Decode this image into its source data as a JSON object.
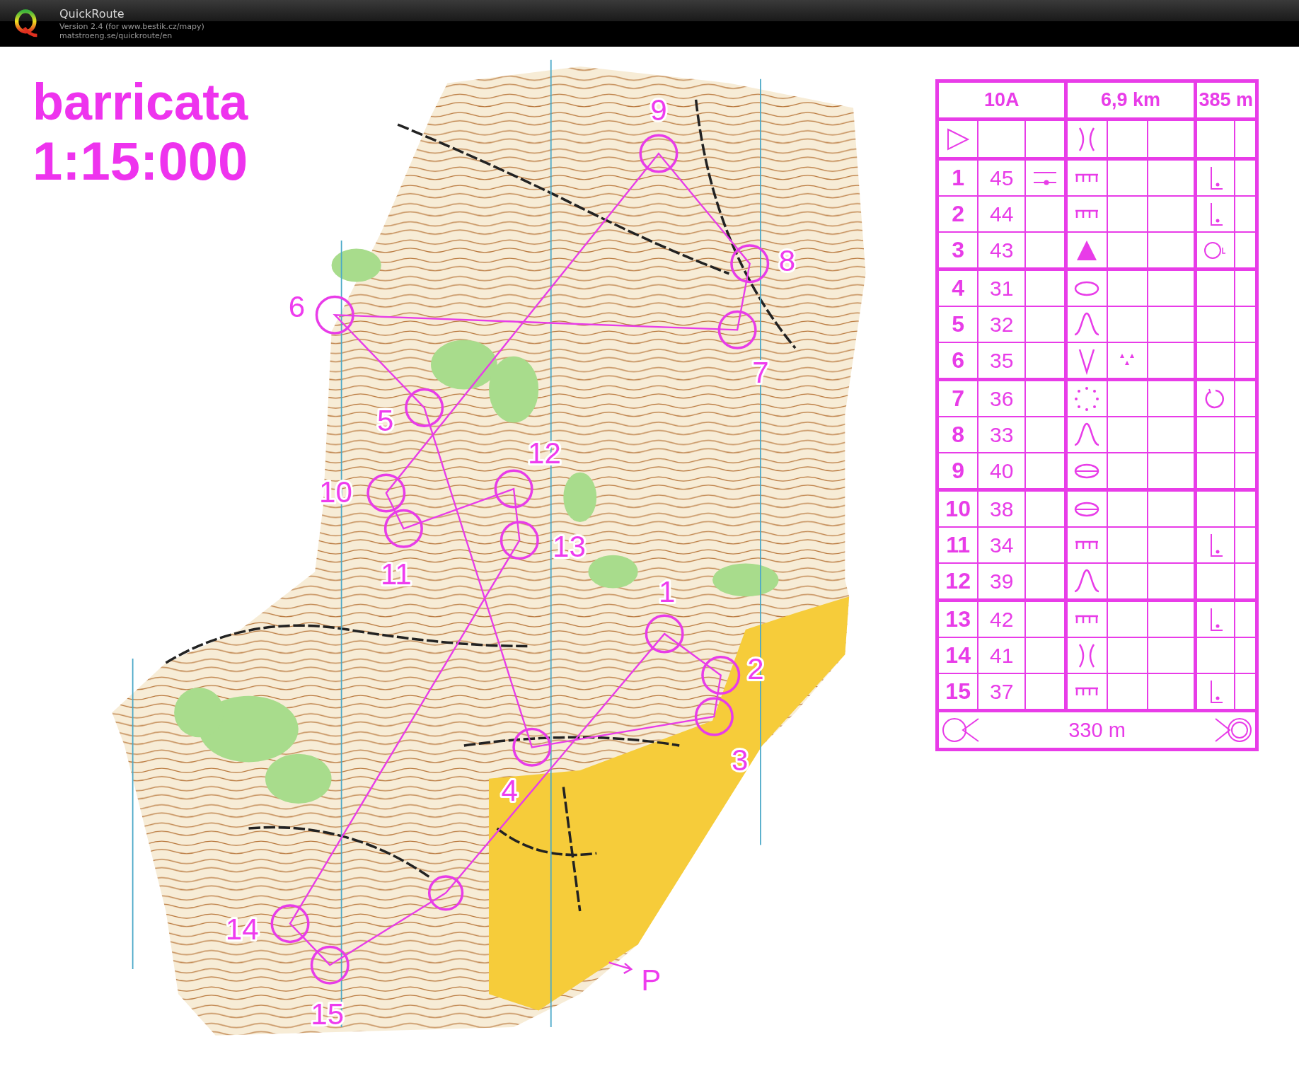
{
  "app_header": {
    "title": "QuickRoute",
    "version": "Version 2.4  (for www.bestik.cz/mapy)",
    "url": "matstroeng.se/quickroute/en"
  },
  "map": {
    "title": "barricata",
    "scale": "1:15:000",
    "parking_label": "P",
    "controls": [
      {
        "number": "1"
      },
      {
        "number": "2"
      },
      {
        "number": "3"
      },
      {
        "number": "4"
      },
      {
        "number": "5"
      },
      {
        "number": "6"
      },
      {
        "number": "7"
      },
      {
        "number": "8"
      },
      {
        "number": "9"
      },
      {
        "number": "10"
      },
      {
        "number": "11"
      },
      {
        "number": "12"
      },
      {
        "number": "13"
      },
      {
        "number": "14"
      },
      {
        "number": "15"
      }
    ]
  },
  "description_sheet": {
    "course": "10A",
    "length": "6,9 km",
    "climb": "385 m",
    "start_row": {
      "column_1": {
        "kind": "triangle"
      },
      "column_4": {
        "kind": "gap"
      }
    },
    "rows": [
      {
        "number": "1",
        "code": "45",
        "column_3": {
          "kind": "crossing"
        },
        "column_4": {
          "kind": "comb"
        },
        "column_7": {
          "kind": "corner-foot"
        }
      },
      {
        "number": "2",
        "code": "44",
        "column_4": {
          "kind": "comb"
        },
        "column_7": {
          "kind": "corner-foot"
        }
      },
      {
        "number": "3",
        "code": "43",
        "column_4": {
          "kind": "triangle-filled"
        },
        "column_7": {
          "kind": "circle-tick"
        }
      },
      {
        "number": "4",
        "code": "31",
        "column_4": {
          "kind": "ellipse"
        }
      },
      {
        "number": "5",
        "code": "32",
        "column_4": {
          "kind": "bell"
        }
      },
      {
        "number": "6",
        "code": "35",
        "column_4": {
          "kind": "v"
        },
        "column_5": {
          "kind": "three-triangles"
        }
      },
      {
        "number": "7",
        "code": "36",
        "column_4": {
          "kind": "dotted-circle"
        },
        "column_7": {
          "kind": "circle-open"
        }
      },
      {
        "number": "8",
        "code": "33",
        "column_4": {
          "kind": "bell"
        }
      },
      {
        "number": "9",
        "code": "40",
        "column_4": {
          "kind": "split-ellipse"
        }
      },
      {
        "number": "10",
        "code": "38",
        "column_4": {
          "kind": "split-ellipse"
        }
      },
      {
        "number": "11",
        "code": "34",
        "column_4": {
          "kind": "comb"
        },
        "column_7": {
          "kind": "corner-foot"
        }
      },
      {
        "number": "12",
        "code": "39",
        "column_4": {
          "kind": "bell"
        }
      },
      {
        "number": "13",
        "code": "42",
        "column_4": {
          "kind": "comb"
        },
        "column_7": {
          "kind": "corner-foot"
        }
      },
      {
        "number": "14",
        "code": "41",
        "column_4": {
          "kind": "gap"
        }
      },
      {
        "number": "15",
        "code": "37",
        "column_4": {
          "kind": "comb"
        },
        "column_7": {
          "kind": "corner-foot"
        }
      }
    ],
    "finish_row": {
      "distance": "330 m"
    }
  }
}
